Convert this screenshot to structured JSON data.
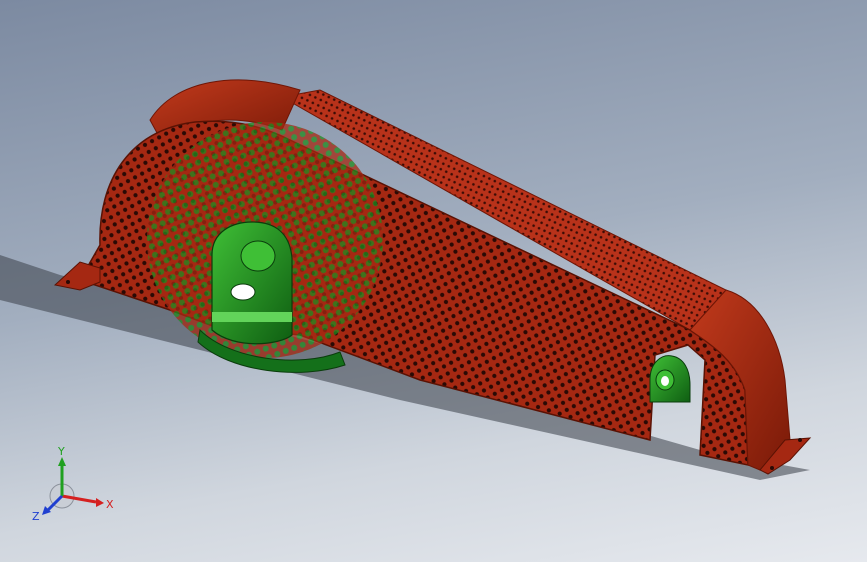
{
  "viewport": {
    "colors": {
      "guard": "#a52812",
      "guard_dark": "#6f1606",
      "guard_light": "#c8391c",
      "sprocket": "#1f9a1f",
      "sprocket_dark": "#0f5e12",
      "sprocket_light": "#42c33a",
      "background_top": "#7c8aa1",
      "background_bottom": "#e6e9ee"
    }
  },
  "triad": {
    "x_label": "X",
    "y_label": "Y",
    "z_label": "Z",
    "x_color": "#d52020",
    "y_color": "#20a020",
    "z_color": "#2040d0"
  }
}
